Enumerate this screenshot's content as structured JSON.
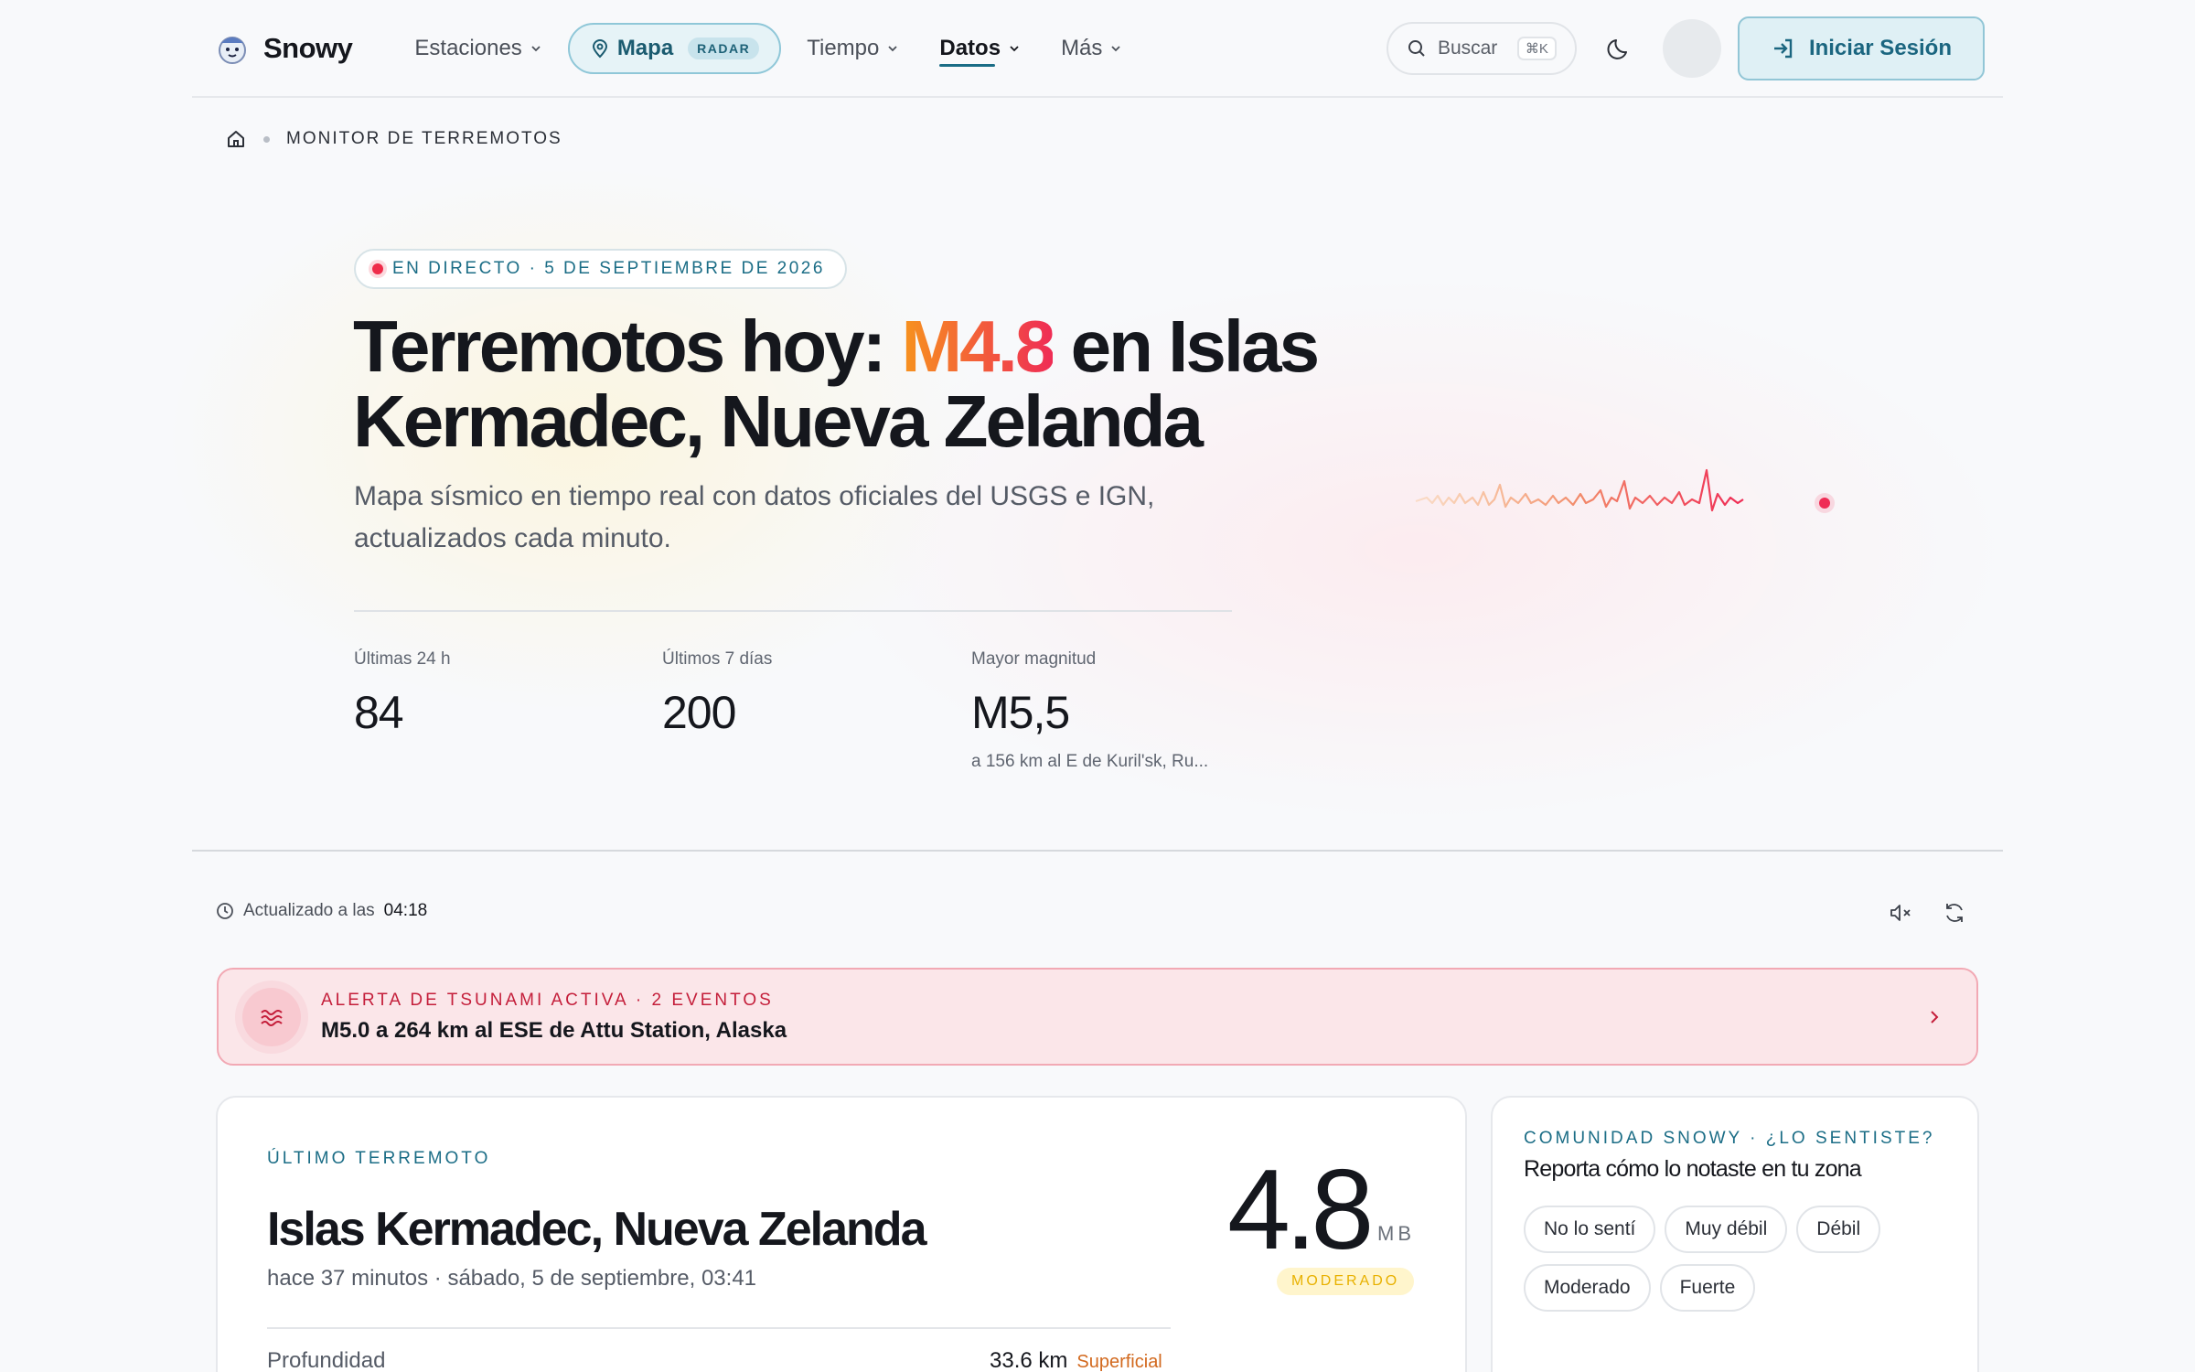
{
  "header": {
    "logo_text": "Snowy",
    "nav": [
      {
        "label": "Estaciones",
        "icon": "chevron-down-icon"
      },
      {
        "label": "Mapa",
        "badge": "RADAR",
        "icon": "map-pin-icon"
      },
      {
        "label": "Tiempo",
        "icon": "chevron-down-icon"
      },
      {
        "label": "Datos",
        "icon": "chevron-down-icon",
        "active": true
      },
      {
        "label": "Más",
        "icon": "chevron-down-icon"
      }
    ],
    "search_label": "Buscar",
    "search_shortcut": "⌘K",
    "login_label": "Iniciar Sesión"
  },
  "breadcrumb": {
    "current": "MONITOR DE TERREMOTOS"
  },
  "hero": {
    "live_label": "EN DIRECTO · 5 DE SEPTIEMBRE DE 2026",
    "title_prefix": "Terremotos hoy: ",
    "title_magnitude": "M4.8",
    "title_suffix": " en Islas Kermadec, Nueva Zelanda",
    "subtitle": "Mapa sísmico en tiempo real con datos oficiales del USGS e IGN, actualizados cada minuto.",
    "stats": [
      {
        "label": "Últimas 24 h",
        "value": "84"
      },
      {
        "label": "Últimos 7 días",
        "value": "200"
      },
      {
        "label": "Mayor magnitud",
        "value": "M5,5",
        "note": "a 156 km al E de Kuril'sk, Ru..."
      }
    ]
  },
  "status": {
    "updated_label": "Actualizado a las",
    "updated_time": "04:18"
  },
  "alert": {
    "heading": "ALERTA DE TSUNAMI ACTIVA · 2 EVENTOS",
    "text": "M5.0 a 264 km al ESE de Attu Station, Alaska"
  },
  "latest": {
    "label": "ÚLTIMO TERREMOTO",
    "title": "Islas Kermadec, Nueva Zelanda",
    "when": "hace 37 minutos · sábado, 5 de septiembre, 03:41",
    "magnitude": "4.8",
    "magnitude_unit": "MB",
    "intensity": "MODERADO",
    "depth_label": "Profundidad",
    "depth_value": "33.6 km",
    "depth_class": "Superficial"
  },
  "community": {
    "label": "COMUNIDAD SNOWY · ¿LO SENTISTE?",
    "title": "Reporta cómo lo notaste en tu zona",
    "options": [
      "No lo sentí",
      "Muy débil",
      "Débil",
      "Moderado",
      "Fuerte"
    ]
  },
  "colors": {
    "accent": "#1b6d86",
    "alert": "#c41e3a",
    "magnitude_start": "#f7931e",
    "magnitude_end": "#ef2c55"
  }
}
